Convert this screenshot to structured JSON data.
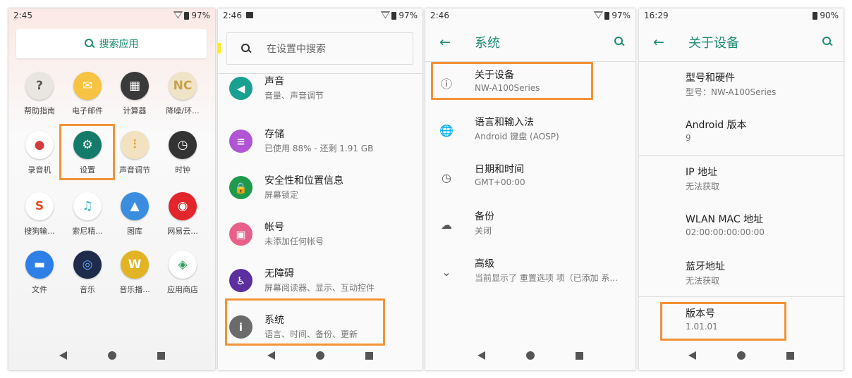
{
  "panel1": {
    "status": {
      "time": "2:45",
      "battery": "97%"
    },
    "search_label": "搜索应用",
    "apps": [
      {
        "label": "帮助指南",
        "glyph": "?",
        "color": "#e9e6e2",
        "fg": "#555",
        "icon": "help-icon"
      },
      {
        "label": "电子邮件",
        "glyph": "✉",
        "color": "#f6c343",
        "fg": "#fff",
        "icon": "email-icon"
      },
      {
        "label": "计算器",
        "glyph": "▦",
        "color": "#3a3a3a",
        "fg": "#fff",
        "icon": "calculator-icon"
      },
      {
        "label": "降噪/环...",
        "glyph": "NC",
        "color": "#f0e4c8",
        "fg": "#c9a14a",
        "icon": "noise-cancel-icon"
      },
      {
        "label": "录音机",
        "glyph": "●",
        "color": "#ffffff",
        "fg": "#d63b3b",
        "icon": "recorder-icon"
      },
      {
        "label": "设置",
        "glyph": "⚙",
        "color": "#167a6a",
        "fg": "#fff",
        "icon": "settings-gear-icon"
      },
      {
        "label": "声音调节",
        "glyph": "⫶",
        "color": "#f3e2c2",
        "fg": "#e39a2f",
        "icon": "equalizer-icon"
      },
      {
        "label": "时钟",
        "glyph": "◷",
        "color": "#333333",
        "fg": "#fff",
        "icon": "clock-icon"
      },
      {
        "label": "搜狗输...",
        "glyph": "S",
        "color": "#ffffff",
        "fg": "#e84b1e",
        "icon": "sogou-icon"
      },
      {
        "label": "索尼精...",
        "glyph": "♫",
        "color": "#ffffff",
        "fg": "#2fb3c9",
        "icon": "sony-music-icon"
      },
      {
        "label": "图库",
        "glyph": "▲",
        "color": "#3b8de0",
        "fg": "#fff",
        "icon": "gallery-icon"
      },
      {
        "label": "网易云...",
        "glyph": "◉",
        "color": "#e3262c",
        "fg": "#fff",
        "icon": "netease-music-icon"
      },
      {
        "label": "文件",
        "glyph": "▬",
        "color": "#2e7fe6",
        "fg": "#fff",
        "icon": "files-icon"
      },
      {
        "label": "音乐",
        "glyph": "◎",
        "color": "#1e2b4a",
        "fg": "#6aa0ff",
        "icon": "music-icon"
      },
      {
        "label": "音乐播...",
        "glyph": "W",
        "color": "#e2b423",
        "fg": "#fff",
        "icon": "walkman-icon"
      },
      {
        "label": "应用商店",
        "glyph": "◈",
        "color": "#ffffff",
        "fg": "#2a9d5c",
        "icon": "app-store-icon"
      }
    ]
  },
  "panel2": {
    "status": {
      "time": "2:46",
      "battery": "97%"
    },
    "search_placeholder": "在设置中搜索",
    "items": [
      {
        "title": "声音",
        "subtitle": "音量、声音调节",
        "color": "#1aa090",
        "glyph": "◀",
        "icon": "sound-icon"
      },
      {
        "title": "存储",
        "subtitle": "已使用 88% - 还剩 1.91 GB",
        "color": "#b054d4",
        "glyph": "≡",
        "icon": "storage-icon"
      },
      {
        "title": "安全性和位置信息",
        "subtitle": "屏幕锁定",
        "color": "#1f9a4c",
        "glyph": "🔒",
        "icon": "lock-icon"
      },
      {
        "title": "帐号",
        "subtitle": "未添加任何帐号",
        "color": "#e85f8a",
        "glyph": "▣",
        "icon": "account-icon"
      },
      {
        "title": "无障碍",
        "subtitle": "屏幕阅读器、显示、互动控件",
        "color": "#5b2f9e",
        "glyph": "♿",
        "icon": "accessibility-icon"
      },
      {
        "title": "系统",
        "subtitle": "语言、时间、备份、更新",
        "color": "#6b6b6b",
        "glyph": "i",
        "icon": "info-icon"
      }
    ]
  },
  "panel3": {
    "status": {
      "time": "2:46",
      "battery": "97%"
    },
    "title": "系统",
    "items": [
      {
        "title": "关于设备",
        "subtitle": "NW-A100Series",
        "glyph": "ⓘ",
        "icon": "info-outline-icon"
      },
      {
        "title": "语言和输入法",
        "subtitle": "Android 键盘 (AOSP)",
        "glyph": "🌐",
        "icon": "globe-icon"
      },
      {
        "title": "日期和时间",
        "subtitle": "GMT+00:00",
        "glyph": "◷",
        "icon": "clock-icon"
      },
      {
        "title": "备份",
        "subtitle": "关闭",
        "glyph": "☁",
        "icon": "cloud-backup-icon"
      },
      {
        "title": "高级",
        "subtitle": "当前显示了 重置选项 项（已添加 系...",
        "glyph": "⌄",
        "icon": "chevron-down-icon"
      }
    ]
  },
  "panel4": {
    "status": {
      "time": "16:29",
      "battery": "90%"
    },
    "title": "关于设备",
    "items": [
      {
        "title": "型号和硬件",
        "subtitle": "型号：NW-A100Series"
      },
      {
        "title": "Android 版本",
        "subtitle": "9"
      },
      {
        "title": "IP 地址",
        "subtitle": "无法获取"
      },
      {
        "title": "WLAN MAC 地址",
        "subtitle": "02:00:00:00:00:00"
      },
      {
        "title": "蓝牙地址",
        "subtitle": "无法获取"
      },
      {
        "title": "版本号",
        "subtitle": "1.01.01"
      }
    ]
  },
  "colors": {
    "accent": "#1c8c72",
    "highlight": "#f39237"
  }
}
